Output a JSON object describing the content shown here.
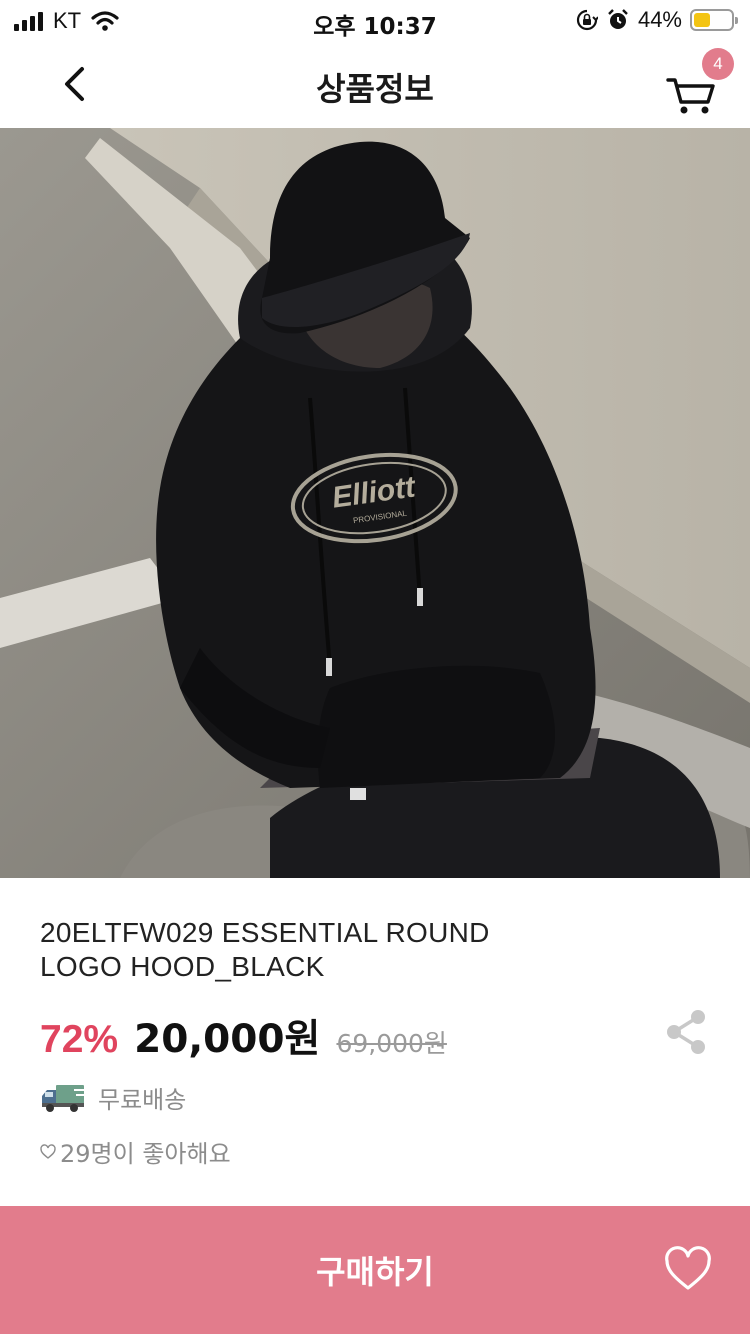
{
  "status_bar": {
    "carrier": "KT",
    "time": "오후 10:37",
    "battery_percent": "44%",
    "battery_level": 0.44
  },
  "nav": {
    "title": "상품정보",
    "cart_count": "4"
  },
  "product": {
    "name_line1": "20ELTFW029 ESSENTIAL ROUND",
    "name_line2": "LOGO HOOD_BLACK",
    "discount": "72%",
    "sale_price": "20,000원",
    "original_price": "69,000원",
    "hoodie_logo": "Elliott",
    "hoodie_logo_sub": "PROVISIONAL",
    "shipping": "무료배송",
    "likes": "29명이 좋아해요"
  },
  "footer": {
    "buy_label": "구매하기"
  },
  "colors": {
    "accent": "#e27c8c",
    "discount": "#e0445e",
    "muted_text": "#8c8c8c"
  },
  "icons": [
    "wifi-icon",
    "lock-rotation-icon",
    "alarm-icon",
    "back-chevron-icon",
    "cart-icon",
    "share-icon",
    "truck-icon",
    "heart-small-icon",
    "heart-icon"
  ]
}
